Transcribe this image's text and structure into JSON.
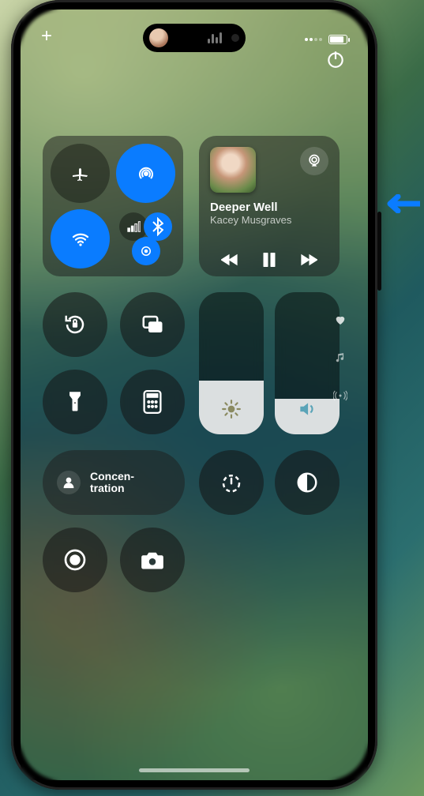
{
  "statusbar": {
    "add_label": "+"
  },
  "media": {
    "track_title": "Deeper Well",
    "artist": "Kacey Musgraves"
  },
  "sliders": {
    "brightness_percent": 38,
    "volume_percent": 25
  },
  "focus": {
    "label": "Concen-\ntration"
  },
  "icons": {
    "airplane": "airplane-icon",
    "airdrop": "airdrop-icon",
    "wifi": "wifi-icon",
    "cellular": "cellular-icon",
    "bluetooth": "bluetooth-icon",
    "hotspot": "personal-hotspot-icon",
    "airplay": "airplay-icon",
    "prev": "previous-track-icon",
    "play_pause": "pause-icon",
    "next": "next-track-icon",
    "lock_rotation": "rotation-lock-icon",
    "screen_mirror": "screen-mirror-icon",
    "flashlight": "flashlight-icon",
    "calculator": "calculator-icon",
    "brightness": "brightness-icon",
    "volume": "volume-icon",
    "focus_person": "person-icon",
    "timer": "timer-icon",
    "dark_mode": "dark-mode-icon",
    "record": "screen-record-icon",
    "camera": "camera-icon",
    "power": "power-icon",
    "page_heart": "heart-icon",
    "page_music": "music-note-icon",
    "page_radio": "radio-waves-icon"
  }
}
